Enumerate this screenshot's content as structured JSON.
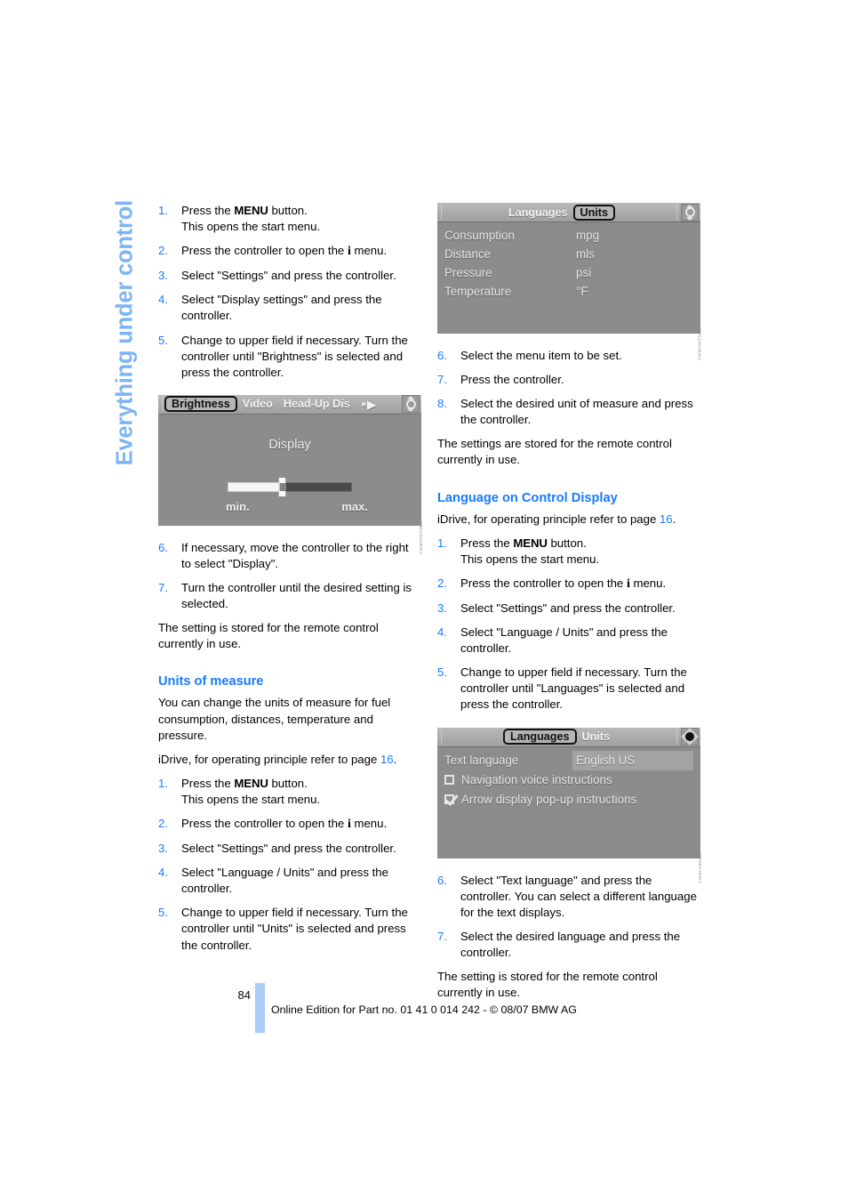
{
  "chapter": {
    "title": "Everything under control"
  },
  "left_column": {
    "steps_display": [
      {
        "n": "1.",
        "html_parts": [
          "Press the ",
          "MENU",
          " button."
        ],
        "line2": "This opens the start menu."
      },
      {
        "n": "2.",
        "pre": "Press the controller to open the ",
        "icon": "i",
        "post": " menu."
      },
      {
        "n": "3.",
        "text": "Select \"Settings\" and press the controller."
      },
      {
        "n": "4.",
        "text": "Select \"Display settings\" and press the controller."
      },
      {
        "n": "5.",
        "text": "Change to upper field if necessary. Turn the controller until \"Brightness\" is selected and press the controller."
      }
    ],
    "screenshot_brightness": {
      "tabs": [
        {
          "label": "Brightness",
          "selected": true
        },
        {
          "label": "Video",
          "selected": false
        },
        {
          "label": "Head-Up Dis",
          "selected": false
        }
      ],
      "more_arrow": "‣▶",
      "icon": "controller-updown-icon",
      "body_title": "Display",
      "min_label": "min.",
      "max_label": "max.",
      "slider_percent": 42,
      "figure_id": "CWMDPDFMBS"
    },
    "steps_display_cont": [
      {
        "n": "6.",
        "text": "If necessary, move the controller to the right to select \"Display\"."
      },
      {
        "n": "7.",
        "text": "Turn the controller until the desired setting is selected."
      }
    ],
    "note_display": "The setting is stored for the remote control currently in use.",
    "heading_units": "Units of measure",
    "units_intro": "You can change the units of measure for fuel consumption, distances, temperature and pressure.",
    "units_idrive_pre": "iDrive, for operating principle refer to page ",
    "units_idrive_page": "16",
    "units_idrive_post": ".",
    "steps_units": [
      {
        "n": "1.",
        "html_parts": [
          "Press the ",
          "MENU",
          " button."
        ],
        "line2": "This opens the start menu."
      },
      {
        "n": "2.",
        "pre": "Press the controller to open the ",
        "icon": "i",
        "post": " menu."
      },
      {
        "n": "3.",
        "text": "Select \"Settings\" and press the controller."
      },
      {
        "n": "4.",
        "text": "Select \"Language / Units\" and press the controller."
      },
      {
        "n": "5.",
        "text": "Change to upper field if necessary. Turn the controller until \"Units\" is selected and press the controller."
      }
    ]
  },
  "right_column": {
    "screenshot_units": {
      "tabs": [
        {
          "label": "Languages",
          "selected": false
        },
        {
          "label": "Units",
          "selected": true
        }
      ],
      "icon": "controller-updown-icon",
      "rows": [
        {
          "key": "Consumption",
          "value": "mpg"
        },
        {
          "key": "Distance",
          "value": "mls"
        },
        {
          "key": "Pressure",
          "value": "psi"
        },
        {
          "key": "Temperature",
          "value": "°F"
        }
      ],
      "figure_id": "CWMUNITSUS"
    },
    "steps_units_cont": [
      {
        "n": "6.",
        "text": "Select the menu item to be set."
      },
      {
        "n": "7.",
        "text": "Press the controller."
      },
      {
        "n": "8.",
        "text": "Select the desired unit of measure and press the controller."
      }
    ],
    "note_units": "The settings are stored for the remote control currently in use.",
    "heading_language": "Language on Control Display",
    "language_idrive_pre": "iDrive, for operating principle refer to page ",
    "language_idrive_page": "16",
    "language_idrive_post": ".",
    "steps_language": [
      {
        "n": "1.",
        "html_parts": [
          "Press the ",
          "MENU",
          " button."
        ],
        "line2": "This opens the start menu."
      },
      {
        "n": "2.",
        "pre": "Press the controller to open the ",
        "icon": "i",
        "post": " menu."
      },
      {
        "n": "3.",
        "text": "Select \"Settings\" and press the controller."
      },
      {
        "n": "4.",
        "text": "Select \"Language / Units\" and press the controller."
      },
      {
        "n": "5.",
        "text": "Change to upper field if necessary. Turn the controller until \"Languages\" is selected and press the controller."
      }
    ],
    "screenshot_language": {
      "tabs": [
        {
          "label": "Languages",
          "selected": true
        },
        {
          "label": "Units",
          "selected": false
        }
      ],
      "icon": "controller-diamond-icon",
      "row_key": "Text language",
      "row_value": "English US",
      "checkbox_items": [
        {
          "label": "Navigation voice instructions",
          "checked": false
        },
        {
          "label": "Arrow display pop-up instructions",
          "checked": true
        }
      ],
      "figure_id": "CWMLANGUS"
    },
    "steps_language_cont": [
      {
        "n": "6.",
        "text": "Select \"Text language\" and press the controller. You can select a different language for the text displays."
      },
      {
        "n": "7.",
        "text": "Select the desired language and press the controller."
      }
    ],
    "note_language": "The setting is stored for the remote control currently in use."
  },
  "footer": {
    "page_number": "84",
    "text": "Online Edition for Part no. 01 41 0 014 242 - © 08/07 BMW AG"
  },
  "colors": {
    "accent_blue": "#1a7aff",
    "tab_blue": "#7db4f5",
    "footer_bar_blue": "#a9cdf7"
  }
}
